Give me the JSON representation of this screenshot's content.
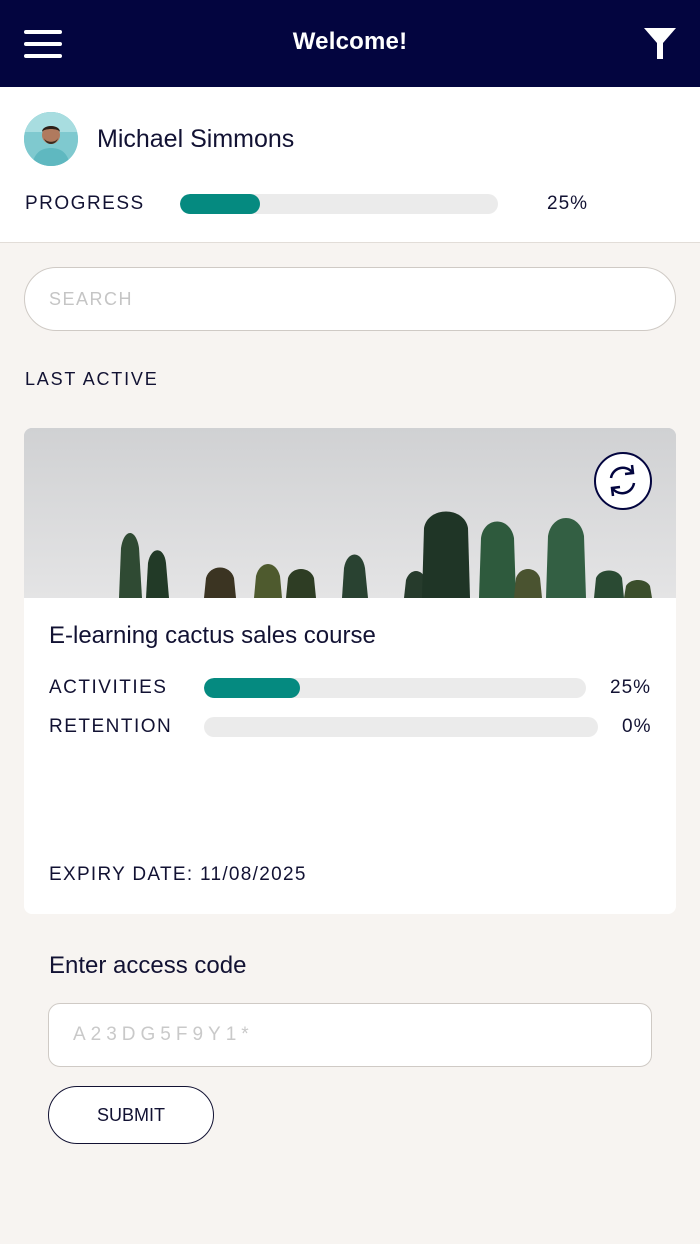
{
  "header": {
    "title": "Welcome!",
    "menu_icon": "hamburger-menu-icon",
    "filter_icon": "filter-funnel-icon",
    "background": "#03053f"
  },
  "profile": {
    "name": "Michael Simmons",
    "progress_label": "PROGRESS",
    "progress_value": 0.25,
    "progress_text": "25%"
  },
  "search": {
    "placeholder": "SEARCH"
  },
  "last_active": {
    "heading": "LAST ACTIVE",
    "card": {
      "title": "E-learning cactus sales course",
      "refresh_icon": "refresh-icon",
      "activities": {
        "label": "ACTIVITIES",
        "value": 0.25,
        "text": "25%"
      },
      "retention": {
        "label": "RETENTION",
        "value": 0,
        "text": "0%"
      },
      "expiry": "EXPIRY DATE: 11/08/2025"
    }
  },
  "access": {
    "label": "Enter access code",
    "placeholder": "A23DG5F9Y1*",
    "submit_label": "SUBMIT"
  },
  "colors": {
    "accent": "#058a80",
    "track": "#ebebeb",
    "background": "#f7f4f1",
    "text": "#121233"
  }
}
